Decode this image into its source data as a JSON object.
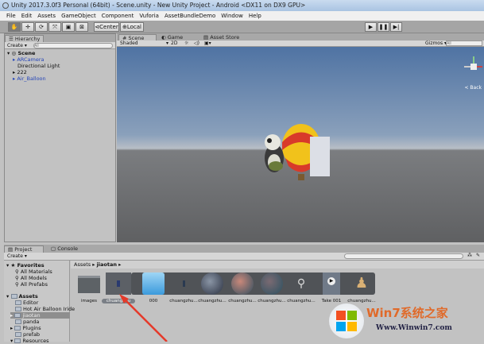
{
  "window": {
    "title": "Unity 2017.3.0f3 Personal (64bit) - Scene.unity - New Unity Project - Android <DX11 on DX9 GPU>"
  },
  "menu": [
    "File",
    "Edit",
    "Assets",
    "GameObject",
    "Component",
    "Vuforia",
    "AssetBundleDemo",
    "Window",
    "Help"
  ],
  "toolbar": {
    "center": "Center",
    "local": "Local",
    "play": "▶",
    "pause": "❚❚",
    "step": "▶|"
  },
  "hierarchy": {
    "tab": "Hierarchy",
    "create": "Create",
    "search_placeholder": "All",
    "scene": "Scene",
    "items": [
      "ARCamera",
      "Directional Light",
      "222",
      "Air_Balloon"
    ]
  },
  "scene_tabs": [
    "Scene",
    "Game",
    "Asset Store"
  ],
  "scene_toolbar": {
    "shading": "Shaded",
    "mode2d": "2D",
    "gizmos": "Gizmos",
    "search_placeholder": "All",
    "persp": "< Back"
  },
  "project": {
    "tabs": [
      "Project",
      "Console"
    ],
    "create": "Create",
    "favorites": {
      "label": "Favorites",
      "items": [
        "All Materials",
        "All Models",
        "All Prefabs"
      ]
    },
    "assets": {
      "label": "Assets",
      "items": [
        "Editor",
        "Hot Air Balloon Iride",
        "jiaotan",
        "panda",
        "Plugins",
        "prefab",
        "Resources"
      ]
    },
    "breadcrumb": [
      "Assets",
      "jiaotan"
    ],
    "files": [
      "images",
      "chuangzhu",
      "000",
      "chuangzhu...",
      "chuangzhu...",
      "chuangzhu...",
      "chuangzhu...",
      "chuangzhu...",
      "Take 001",
      "chuangzhu..."
    ]
  },
  "watermark": {
    "brand": "Win7系统之家",
    "url": "Www.Winwin7.com"
  }
}
